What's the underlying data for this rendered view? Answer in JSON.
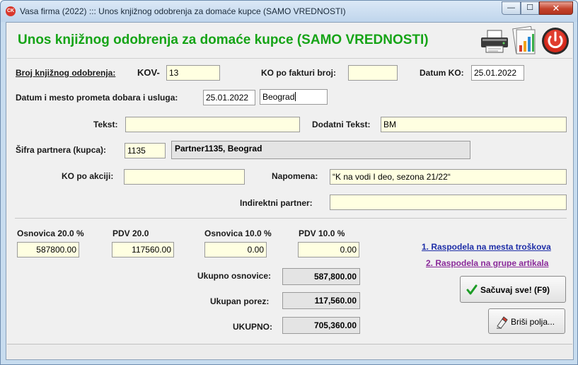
{
  "window": {
    "app_icon": "CK",
    "title": "Vasa firma (2022) ::: Unos knjižnog odobrenja za domaće kupce (SAMO VREDNOSTI)",
    "min_glyph": "—",
    "max_glyph": "☐",
    "close_glyph": "✕"
  },
  "header": {
    "title": "Unos knjižnog odobrenja za domaće kupce (SAMO VREDNOSTI)",
    "icons": [
      "printer-icon",
      "chart-report-icon",
      "power-exit-icon"
    ]
  },
  "form": {
    "broj_label": "Broj knjižnog odobrenja:",
    "broj_prefix": "KOV-",
    "broj_value": "13",
    "ko_faktura_label": "KO po fakturi broj:",
    "ko_faktura_value": "",
    "datum_ko_label": "Datum KO:",
    "datum_ko_value": "25.01.2022",
    "datum_mesto_label": "Datum i mesto prometa dobara i usluga:",
    "datum_prometa_value": "25.01.2022",
    "mesto_prometa_value": "Beograd",
    "tekst_label": "Tekst:",
    "tekst_value": "",
    "dodatni_label": "Dodatni Tekst:",
    "dodatni_value": "BM",
    "sifra_label": "Šifra partnera (kupca):",
    "sifra_value": "1135",
    "partner_name": "Partner1135, Beograd",
    "ko_akciji_label": "KO po akciji:",
    "ko_akciji_value": "",
    "napomena_label": "Napomena:",
    "napomena_value": "“K na vodi   I deo, sezona 21/22“",
    "indirektni_label": "Indirektni partner:",
    "indirektni_value": ""
  },
  "amounts": {
    "osnovica20_label": "Osnovica 20.0 %",
    "osnovica20_value": "587800.00",
    "pdv20_label": "PDV  20.0",
    "pdv20_value": "117560.00",
    "osnovica10_label": "Osnovica  10.0 %",
    "osnovica10_value": "0.00",
    "pdv10_label": "PDV  10.0 %",
    "pdv10_value": "0.00",
    "ukupno_osnovice_label": "Ukupno osnovice:",
    "ukupno_osnovice_value": "587,800.00",
    "ukupan_porez_label": "Ukupan porez:",
    "ukupan_porez_value": "117,560.00",
    "ukupno_label": "UKUPNO:",
    "ukupno_value": "705,360.00"
  },
  "actions": {
    "link1": "1. Raspodela na mesta troškova",
    "link2": "2. Raspodela na grupe artikala",
    "save": "Sačuvaj sve! (F9)",
    "clear": "Briši polja...",
    "link1_color": "#1f2fa8",
    "link2_color": "#8a2a9a",
    "save_icon": "checkmark-icon",
    "clear_icon": "eraser-icon"
  }
}
